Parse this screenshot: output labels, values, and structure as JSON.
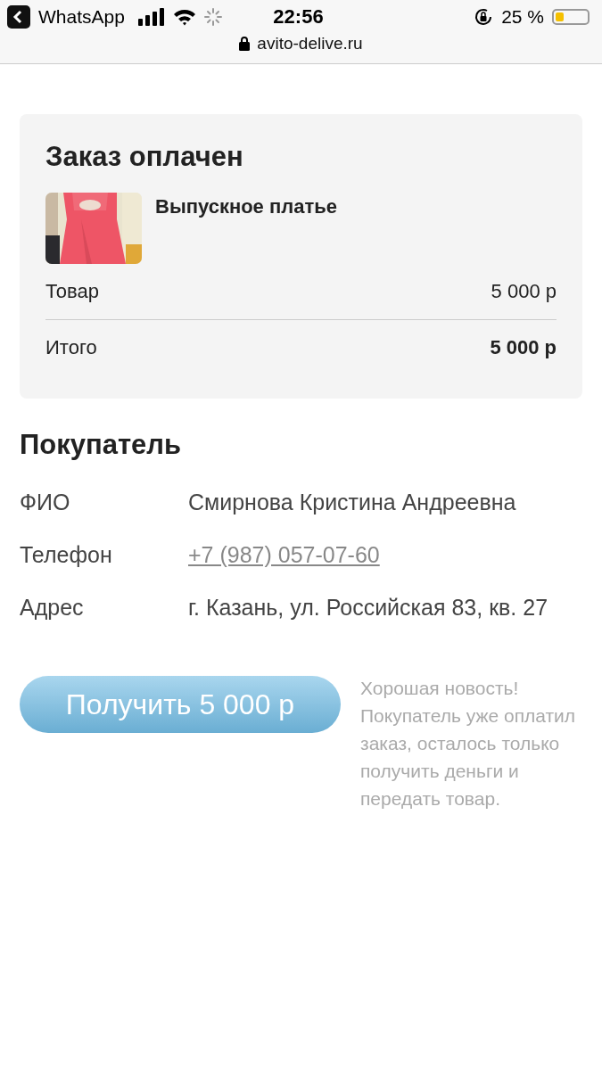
{
  "status_bar": {
    "back_app": "WhatsApp",
    "time": "22:56",
    "battery": "25 %"
  },
  "address_bar": {
    "url": "avito-delive.ru"
  },
  "order": {
    "title": "Заказ оплачен",
    "item": {
      "kind": "picture",
      "name": "Выпускное платье"
    },
    "lines": [
      {
        "label": "Товар",
        "value": "5 000 р",
        "total": false
      },
      {
        "label": "Итого",
        "value": "5 000 р",
        "total": true
      }
    ]
  },
  "buyer": {
    "title": "Покупатель",
    "fields": [
      {
        "label": "ФИО",
        "value": "Смирнова Кристина Андреевна",
        "kind": "text"
      },
      {
        "label": "Телефон",
        "value": "+7 (987) 057-07-60",
        "kind": "link"
      },
      {
        "label": "Адрес",
        "value": "г. Казань, ул. Российская 83, кв. 27",
        "kind": "text"
      }
    ]
  },
  "action": {
    "button": "Получить 5 000 р",
    "note": "Хорошая новость! Покупатель уже оплатил заказ, осталось только получить деньги и передать товар."
  }
}
